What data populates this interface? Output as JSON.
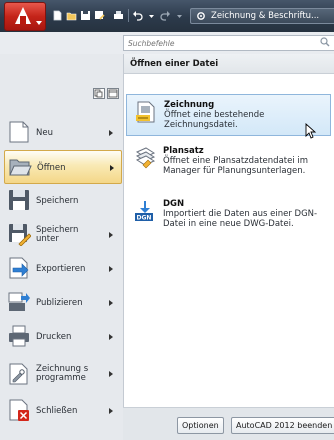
{
  "titlebar": {
    "workspace_label": "Zeichnung & Beschriftu...",
    "quick_access": [
      "new-icon",
      "open-icon",
      "save-icon",
      "save-as-icon",
      "print-icon",
      "undo-icon",
      "redo-icon",
      "settings-icon"
    ]
  },
  "search": {
    "placeholder": "Suchbefehle"
  },
  "menu": {
    "items": [
      {
        "label": "Neu",
        "icon": "new-drawing-icon",
        "submenu": true
      },
      {
        "label": "Öffnen",
        "icon": "open-folder-icon",
        "submenu": true,
        "active": true
      },
      {
        "label": "Speichern",
        "icon": "save-disk-icon",
        "submenu": false
      },
      {
        "label": "Speichern unter",
        "icon": "save-as-icon",
        "submenu": true
      },
      {
        "label": "Exportieren",
        "icon": "export-icon",
        "submenu": true
      },
      {
        "label": "Publizieren",
        "icon": "publish-icon",
        "submenu": true
      },
      {
        "label": "Drucken",
        "icon": "printer-icon",
        "submenu": true
      },
      {
        "label": "Zeichnung s programme",
        "icon": "drawing-utilities-icon",
        "submenu": true
      },
      {
        "label": "Schließen",
        "icon": "close-drawing-icon",
        "submenu": true
      }
    ]
  },
  "submenu": {
    "title": "Öffnen einer Datei",
    "items": [
      {
        "title": "Zeichnung",
        "description": "Öffnet eine bestehende Zeichnungsdatei.",
        "icon": "dwg-file-icon"
      },
      {
        "title": "Plansatz",
        "description": "Öffnet eine Plansatzdatendatei im Manager für Planungsunterlagen.",
        "icon": "sheet-set-icon"
      },
      {
        "title": "DGN",
        "description": "Importiert die Daten aus einer DGN-Datei in eine neue DWG-Datei.",
        "icon": "dgn-import-icon"
      }
    ]
  },
  "footer": {
    "options_label": "Optionen",
    "exit_label": "AutoCAD 2012 beenden"
  },
  "colors": {
    "titlebar": "#2c3a4b",
    "app_button": "#c42419",
    "active_item": "#f9e9b4",
    "hover_item": "#d3e8f8"
  }
}
